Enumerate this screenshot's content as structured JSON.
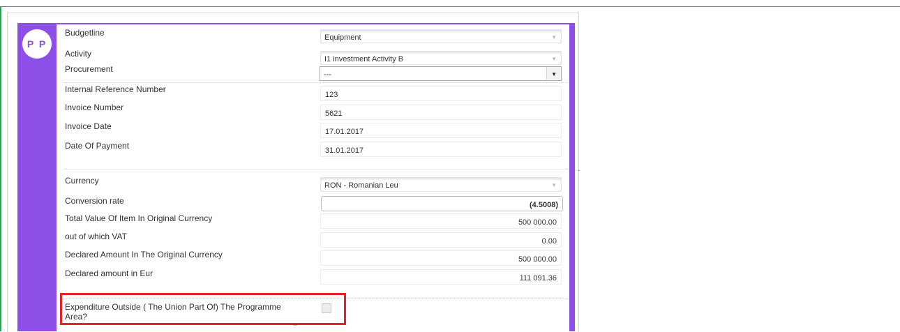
{
  "avatar": {
    "initials": "P P",
    "color": "#8d4fe8"
  },
  "form": {
    "budgetline": {
      "label": "Budgetline",
      "value": "Equipment"
    },
    "activity": {
      "label": "Activity",
      "value": "I1 investment Activity B"
    },
    "procurement": {
      "label": "Procurement",
      "value": "---"
    },
    "internal_reference": {
      "label": "Internal Reference Number",
      "value": "123"
    },
    "invoice_number": {
      "label": "Invoice Number",
      "value": "5621"
    },
    "invoice_date": {
      "label": "Invoice Date",
      "value": "17.01.2017"
    },
    "date_of_payment": {
      "label": "Date Of Payment",
      "value": "31.01.2017"
    },
    "currency": {
      "label": "Currency",
      "value": "RON - Romanian Leu"
    },
    "conversion_rate": {
      "label": "Conversion rate",
      "value": "(4.5008)"
    },
    "total_value": {
      "label": "Total Value Of Item In Original Currency",
      "value": "500 000.00"
    },
    "vat": {
      "label": "out of which VAT",
      "value": "0.00"
    },
    "declared_original": {
      "label": "Declared Amount In The Original Currency",
      "value": "500 000.00"
    },
    "declared_eur": {
      "label": "Declared amount in Eur",
      "value": "111 091.36"
    },
    "expenditure_outside": {
      "label_line1": "Expenditure Outside ( The Union Part Of) The Programme",
      "label_line2": "Area?",
      "checked": false
    }
  },
  "colors": {
    "accent": "#8d4fe8",
    "highlight": "#e8202a",
    "frame": "#1faa4b"
  }
}
